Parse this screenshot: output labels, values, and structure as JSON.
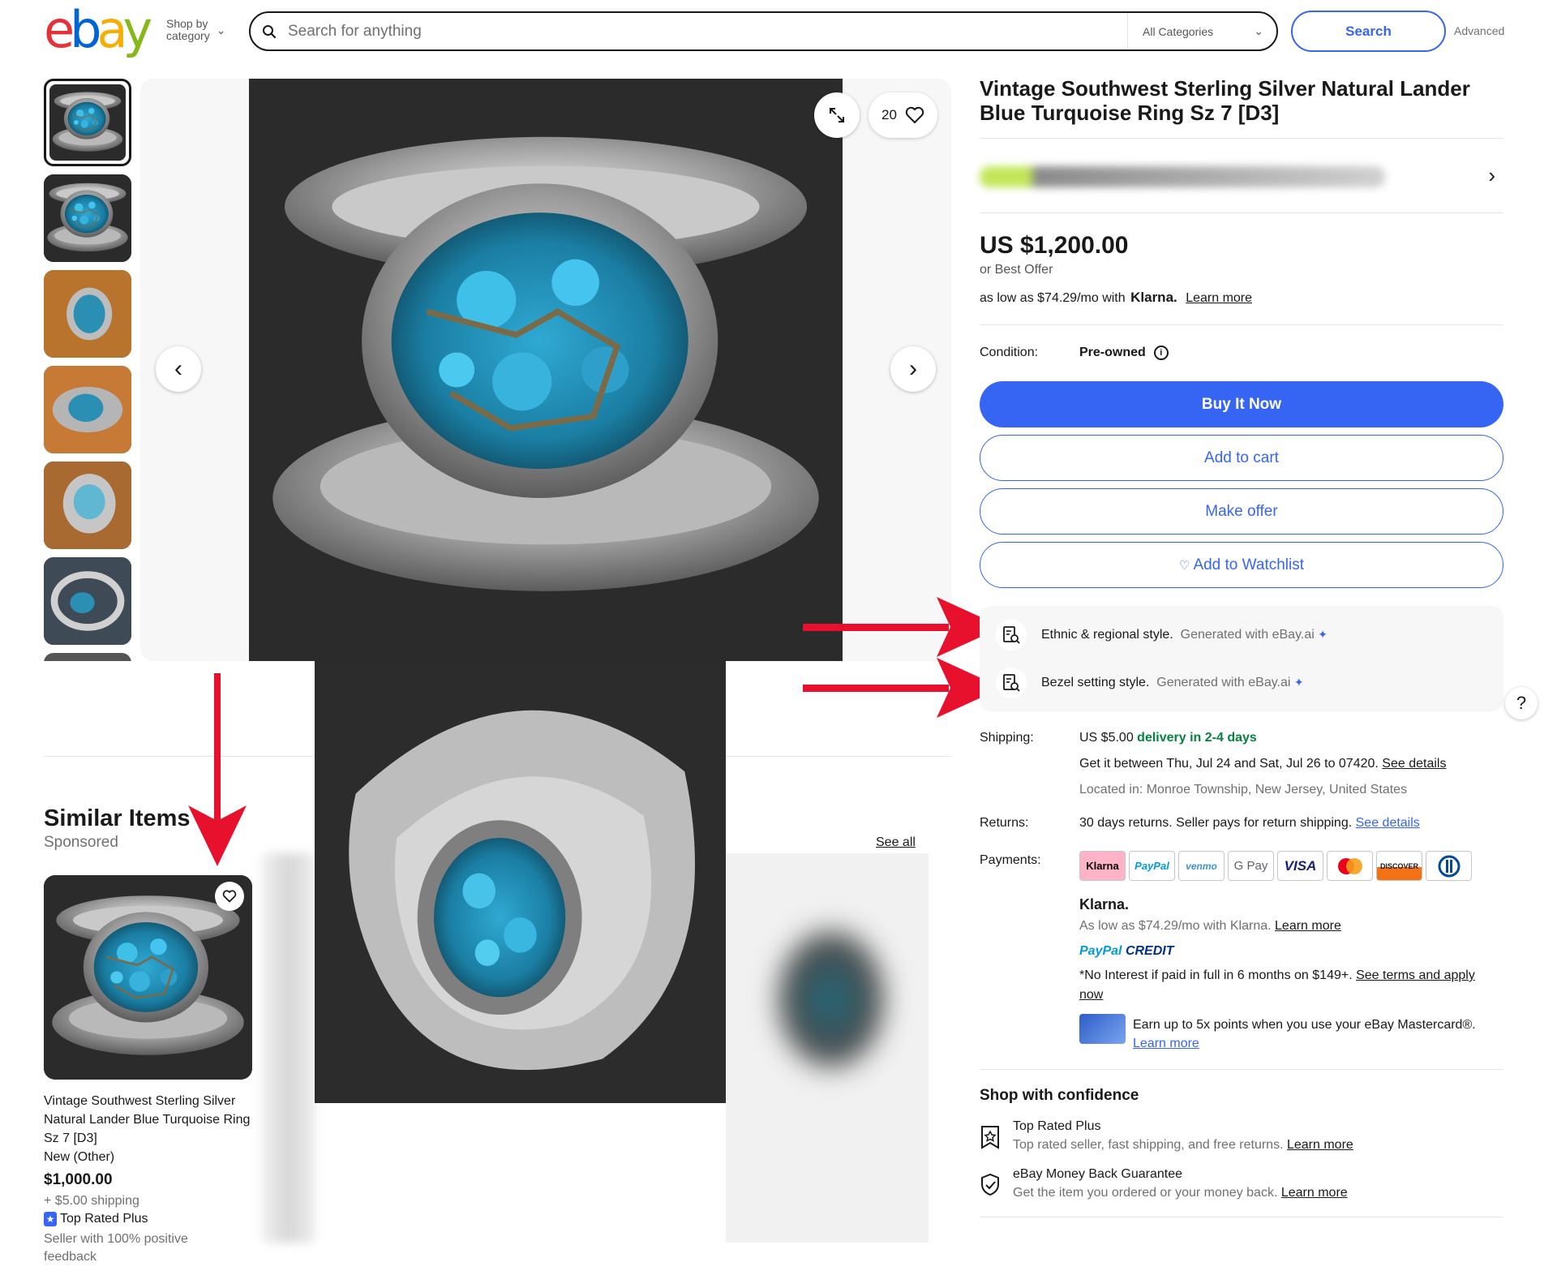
{
  "header": {
    "logo_letters": [
      "e",
      "b",
      "a",
      "y"
    ],
    "shop_by_line1": "Shop by",
    "shop_by_line2": "category",
    "search_placeholder": "Search for anything",
    "category_select": "All Categories",
    "search_button": "Search",
    "advanced_link": "Advanced"
  },
  "gallery": {
    "watch_count": "20",
    "thumbnail_count": 6
  },
  "listing": {
    "title": "Vintage Southwest Sterling Silver Natural Lander Blue Turquoise Ring Sz 7 [D3]",
    "price": "US $1,200.00",
    "best_offer": "or Best Offer",
    "klarna_prefix": "as low as $74.29/mo with",
    "klarna_brand": "Klarna.",
    "klarna_learn_more": "Learn more",
    "condition_label": "Condition:",
    "condition_value": "Pre-owned",
    "buy_now": "Buy It Now",
    "add_to_cart": "Add to cart",
    "make_offer": "Make offer",
    "add_to_watchlist": "Add to Watchlist"
  },
  "ai_insights": [
    {
      "label": "Ethnic & regional style.",
      "generated": "Generated with eBay.ai"
    },
    {
      "label": "Bezel setting style.",
      "generated": "Generated with eBay.ai"
    }
  ],
  "shipping": {
    "label": "Shipping:",
    "cost": "US $5.00",
    "speed": "delivery in 2-4 days",
    "estimate": "Get it between Thu, Jul 24 and Sat, Jul 26 to 07420.",
    "see_details": "See details",
    "location": "Located in: Monroe Township, New Jersey, United States"
  },
  "returns": {
    "label": "Returns:",
    "text": "30 days returns. Seller pays for return shipping.",
    "see_details": "See details"
  },
  "payments": {
    "label": "Payments:",
    "logos": [
      "Klarna",
      "PayPal",
      "venmo",
      "G Pay",
      "VISA",
      "Mastercard",
      "DISCOVER",
      "Diners Club"
    ],
    "klarna_heading": "Klarna.",
    "klarna_text": "As low as $74.29/mo with Klarna.",
    "klarna_learn_more": "Learn more",
    "paypal_credit_a": "PayPal",
    "paypal_credit_b": "CREDIT",
    "paypal_text": "*No Interest if paid in full in 6 months on $149+.",
    "paypal_link_1": "See terms and apply",
    "paypal_link_2": "now",
    "card_text": "Earn up to 5x points when you use your eBay Mastercard®.",
    "card_learn_more": "Learn more"
  },
  "confidence": {
    "title": "Shop with confidence",
    "items": [
      {
        "title": "Top Rated Plus",
        "desc": "Top rated seller, fast shipping, and free returns.",
        "link": "Learn more",
        "icon": "top-rated-badge-icon"
      },
      {
        "title": "eBay Money Back Guarantee",
        "desc": "Get the item you ordered or your money back.",
        "link": "Learn more",
        "icon": "shield-check-icon"
      }
    ]
  },
  "similar": {
    "title": "Similar Items",
    "sponsored": "Sponsored",
    "see_all": "See all",
    "card": {
      "title": "Vintage Southwest Sterling Silver Natural Lander Blue Turquoise Ring Sz 7 [D3]",
      "condition": "New (Other)",
      "price": "$1,000.00",
      "shipping": "+ $5.00 shipping",
      "badge": "Top Rated Plus",
      "seller": "Seller with 100% positive feedback"
    }
  },
  "colors": {
    "primary_blue": "#3665f3",
    "annotation_red": "#e8112d",
    "delivery_green": "#05823f",
    "turquoise": "#2a9fc4"
  },
  "help_label": "?"
}
